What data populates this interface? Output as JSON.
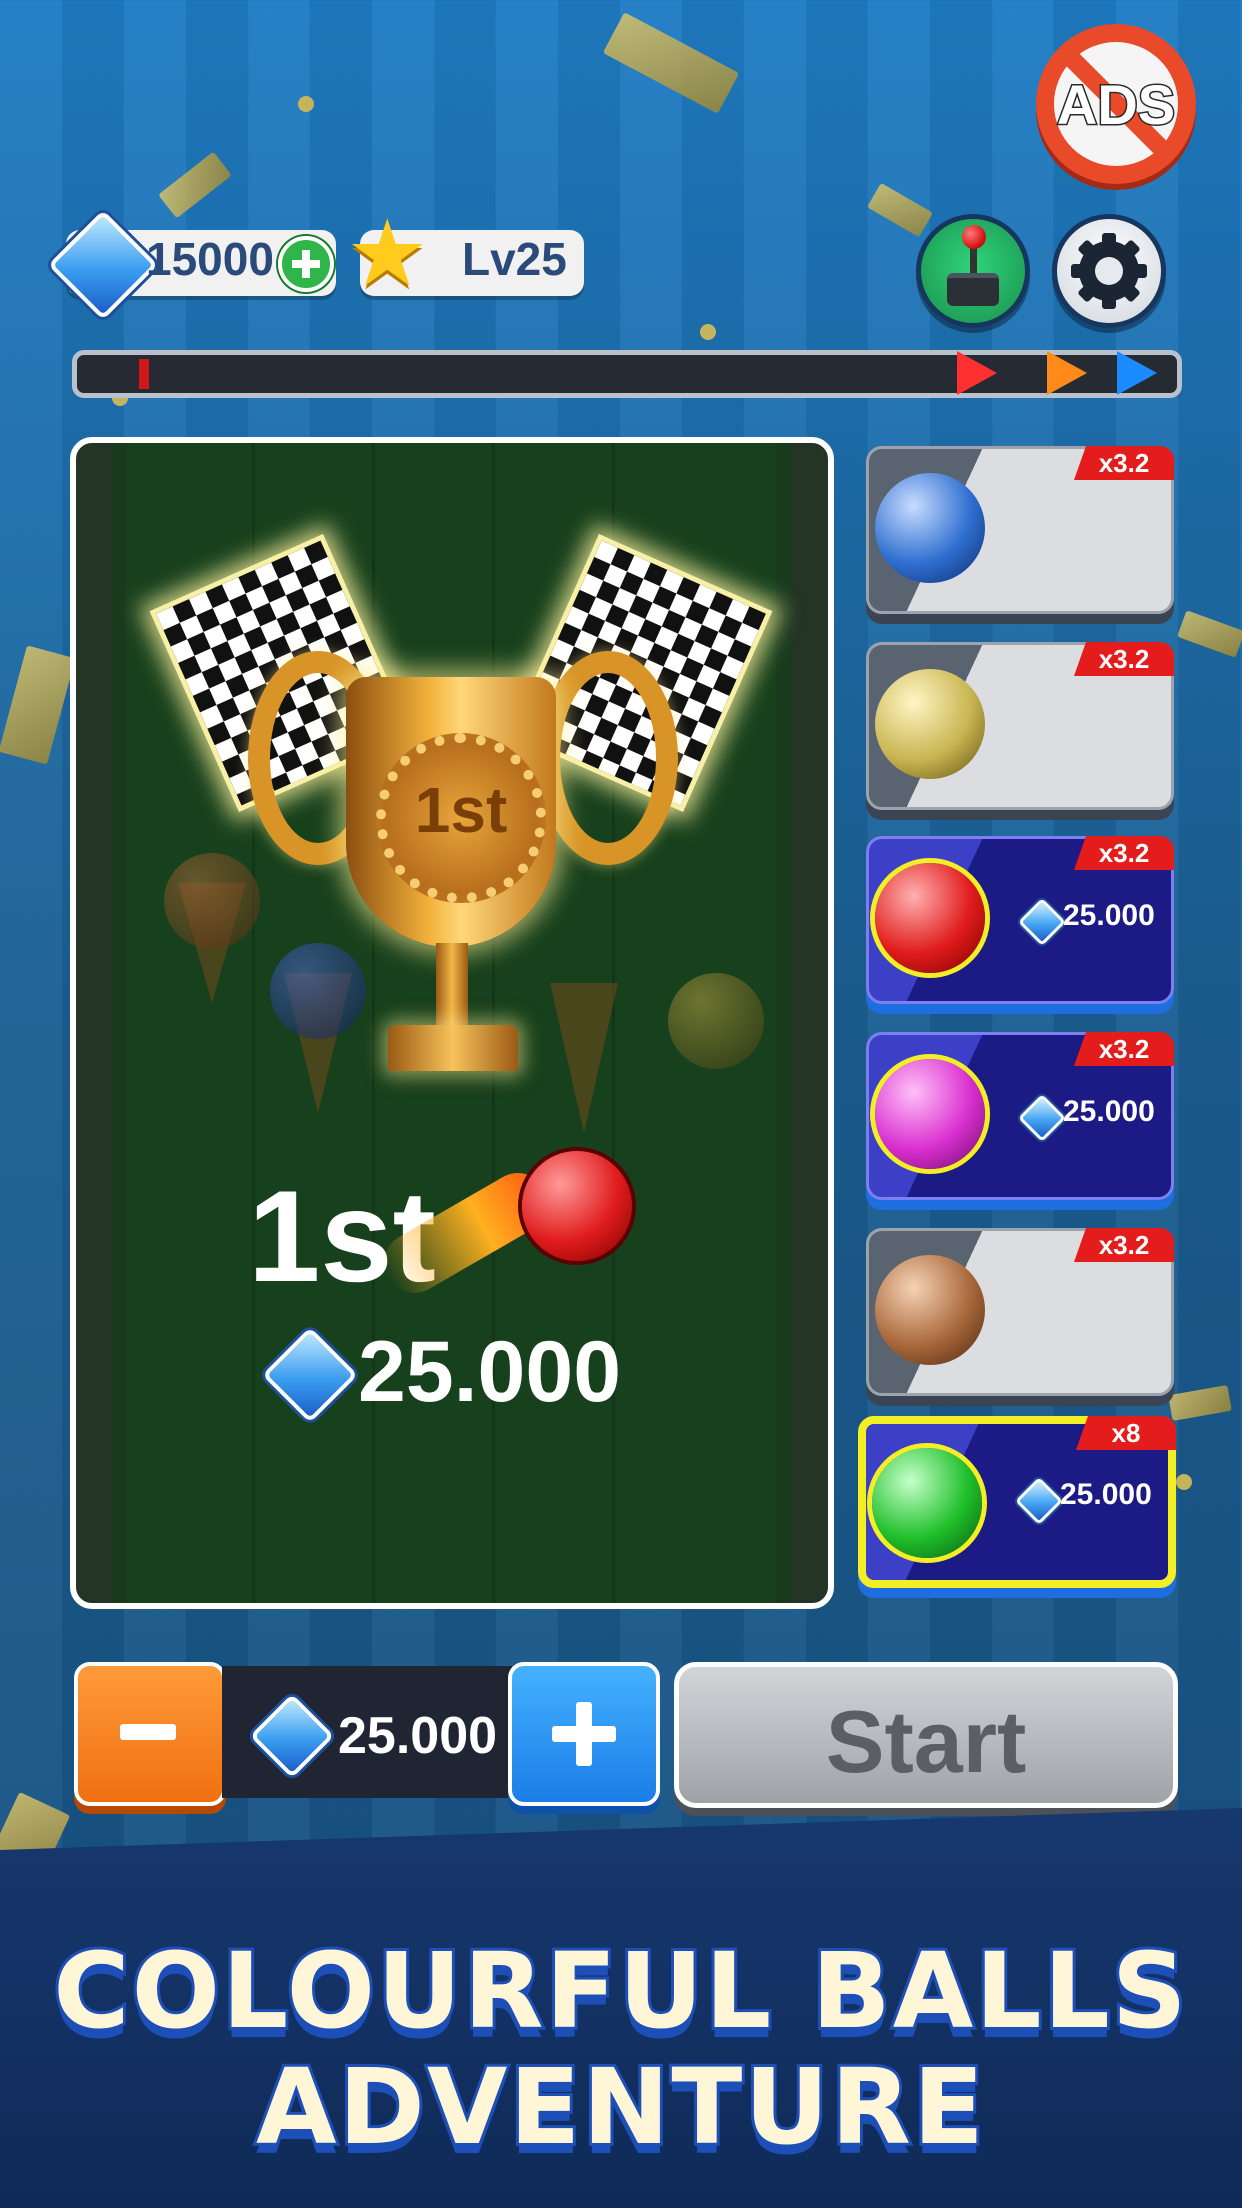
{
  "header": {
    "gems": "15000",
    "level": "Lv25",
    "ads_label": "ADS"
  },
  "icons": {
    "gem": "diamond-gem-icon",
    "add": "plus-icon",
    "level": "star-icon",
    "arcade": "joystick-icon",
    "settings": "gear-icon",
    "no_ads": "no-ads-icon"
  },
  "progress": {
    "value": 0.04,
    "finish_markers": [
      "#ff3030",
      "#ff8a1a",
      "#1a8cff"
    ]
  },
  "result": {
    "cup_label": "1st",
    "place": "1st",
    "prize": "25.000"
  },
  "balls": [
    {
      "color": "#2f6fd0",
      "multiplier": "x3.2",
      "price": "",
      "state": "locked"
    },
    {
      "color": "#c9b552",
      "multiplier": "x3.2",
      "price": "",
      "state": "locked"
    },
    {
      "color": "#e01b1b",
      "multiplier": "x3.2",
      "price": "25.000",
      "state": "available"
    },
    {
      "color": "#d92fd0",
      "multiplier": "x3.2",
      "price": "25.000",
      "state": "available"
    },
    {
      "color": "#a8683a",
      "multiplier": "x3.2",
      "price": "",
      "state": "locked"
    },
    {
      "color": "#1fbf2a",
      "multiplier": "x8",
      "price": "25.000",
      "state": "selected"
    }
  ],
  "bet": {
    "amount": "25.000",
    "start_label": "Start"
  },
  "banner": {
    "line1": "COLOURFUL BALLS",
    "line2": "ADVENTURE"
  }
}
